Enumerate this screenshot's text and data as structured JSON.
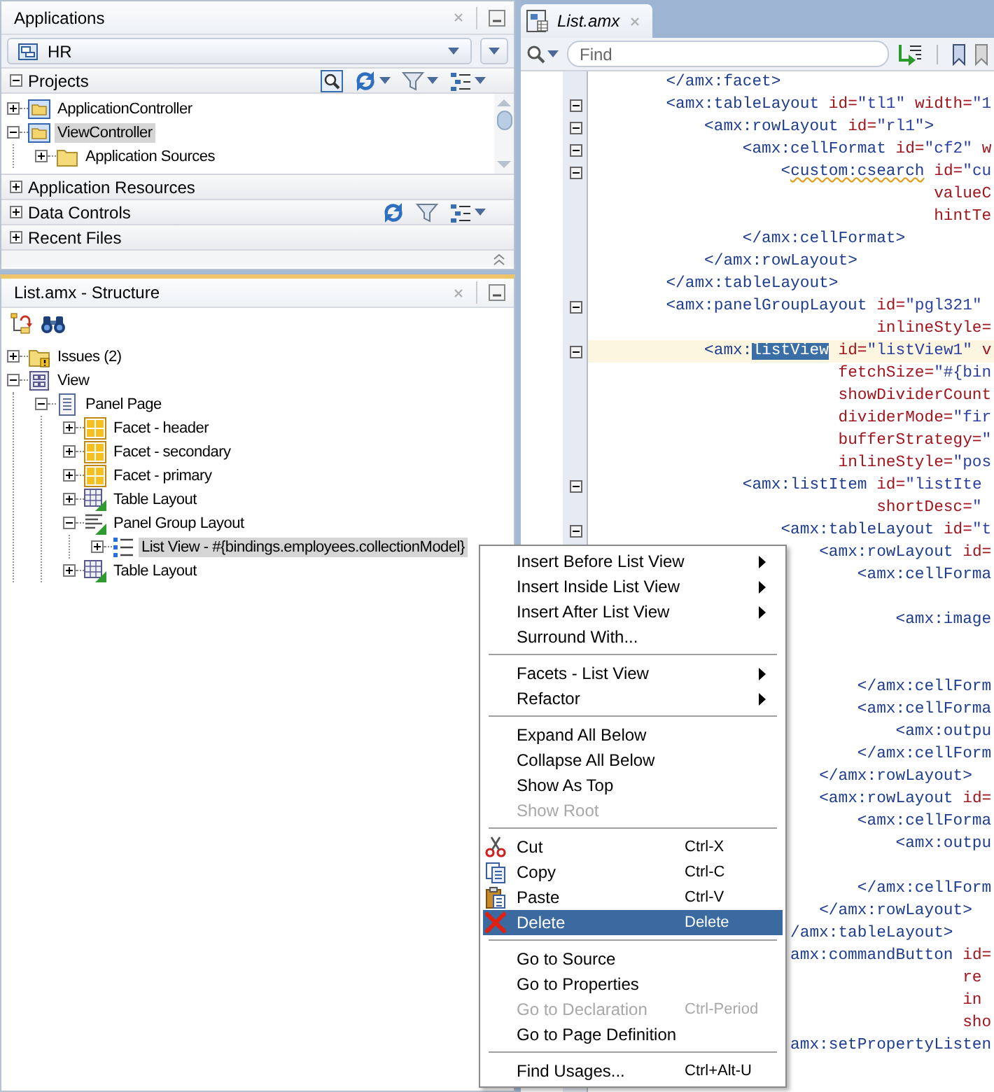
{
  "applications": {
    "title": "Applications",
    "application": "HR",
    "sections": [
      {
        "title": "Projects",
        "expanded": true,
        "tree": [
          {
            "label": "ApplicationController",
            "kind": "project",
            "expanded": false,
            "selected": false
          },
          {
            "label": "ViewController",
            "kind": "project",
            "expanded": true,
            "selected": true,
            "children": [
              {
                "label": "Application Sources",
                "kind": "folder",
                "expanded": false,
                "selected": false
              }
            ]
          }
        ]
      },
      {
        "title": "Application Resources",
        "expanded": false
      },
      {
        "title": "Data Controls",
        "expanded": false
      },
      {
        "title": "Recent Files",
        "expanded": false
      }
    ]
  },
  "structure": {
    "title": "List.amx - Structure",
    "tree": [
      {
        "label": "Issues (2)",
        "kind": "issues",
        "expanded": false,
        "selected": false
      },
      {
        "label": "View",
        "kind": "view",
        "expanded": true,
        "selected": false,
        "children": [
          {
            "label": "Panel Page",
            "kind": "page",
            "expanded": true,
            "selected": false,
            "children": [
              {
                "label": "Facet - header",
                "kind": "facet",
                "expanded": false,
                "selected": false
              },
              {
                "label": "Facet - secondary",
                "kind": "facet",
                "expanded": false,
                "selected": false
              },
              {
                "label": "Facet - primary",
                "kind": "facet",
                "expanded": false,
                "selected": false
              },
              {
                "label": "Table Layout",
                "kind": "table",
                "expanded": false,
                "selected": false
              },
              {
                "label": "Panel Group Layout",
                "kind": "panel_group",
                "expanded": true,
                "selected": false,
                "children": [
                  {
                    "label": "List View - #{bindings.employees.collectionModel}",
                    "kind": "list_view",
                    "expanded": false,
                    "selected": true
                  }
                ]
              },
              {
                "label": "Table Layout",
                "kind": "table",
                "expanded": false,
                "selected": false
              }
            ]
          }
        ]
      }
    ]
  },
  "editor": {
    "tabs": [
      {
        "label": "List.amx",
        "selected": true
      }
    ],
    "search": {
      "placeholder": "Find"
    },
    "lines": [
      {
        "kind": "code",
        "text": "        </amx:facet>",
        "fold": false,
        "current": false
      },
      {
        "kind": "code",
        "text": "        <amx:tableLayout id=\"tl1\" width=\"1",
        "fold": true,
        "current": false
      },
      {
        "kind": "code",
        "text": "            <amx:rowLayout id=\"rl1\">",
        "fold": true,
        "current": false
      },
      {
        "kind": "code",
        "text": "                <amx:cellFormat id=\"cf2\" w",
        "fold": true,
        "current": false
      },
      {
        "kind": "code",
        "segments": [
          {
            "text": "                    <",
            "kind": "plain"
          },
          {
            "text": "custom:csearch",
            "kind": "warning"
          },
          {
            "text": " id=\"cu",
            "kind": "plain"
          }
        ],
        "fold": true,
        "current": false
      },
      {
        "kind": "code",
        "text": "                                    valueC",
        "fold": false,
        "current": false
      },
      {
        "kind": "code",
        "text": "                                    hintTe",
        "fold": false,
        "current": false
      },
      {
        "kind": "code",
        "text": "                </amx:cellFormat>",
        "fold": false,
        "current": false
      },
      {
        "kind": "code",
        "text": "            </amx:rowLayout>",
        "fold": false,
        "current": false
      },
      {
        "kind": "code",
        "text": "        </amx:tableLayout>",
        "fold": false,
        "current": false
      },
      {
        "kind": "code",
        "text": "        <amx:panelGroupLayout id=\"pgl321\"",
        "fold": true,
        "current": false
      },
      {
        "kind": "code",
        "text": "                              inlineStyle=",
        "fold": false,
        "current": false
      },
      {
        "kind": "code",
        "segments": [
          {
            "text": "            <amx:",
            "kind": "plain"
          },
          {
            "text": "listView",
            "kind": "selected"
          },
          {
            "text": " id=\"listView1\" v",
            "kind": "plain"
          }
        ],
        "fold": true,
        "current": true
      },
      {
        "kind": "code",
        "text": "                          fetchSize=\"#{bin",
        "fold": false,
        "current": false
      },
      {
        "kind": "code",
        "text": "                          showDividerCount",
        "fold": false,
        "current": false
      },
      {
        "kind": "code",
        "text": "                          dividerMode=\"fir",
        "fold": false,
        "current": false
      },
      {
        "kind": "code",
        "text": "                          bufferStrategy=\"",
        "fold": false,
        "current": false
      },
      {
        "kind": "code",
        "text": "                          inlineStyle=\"pos",
        "fold": false,
        "current": false
      },
      {
        "kind": "code",
        "text": "                <amx:listItem id=\"listIte",
        "fold": true,
        "current": false
      },
      {
        "kind": "code",
        "text": "                              shortDesc=\"",
        "fold": false,
        "current": false
      },
      {
        "kind": "code",
        "text": "                    <amx:tableLayout id=\"t",
        "fold": true,
        "current": false
      },
      {
        "kind": "code",
        "text": "                        <amx:rowLayout id=",
        "fold": false,
        "current": false
      },
      {
        "kind": "code",
        "text": "                            <amx:cellForma",
        "fold": false,
        "current": false
      },
      {
        "kind": "blank",
        "fold": false,
        "current": false
      },
      {
        "kind": "code",
        "text": "                                <amx:image",
        "fold": false,
        "current": false
      },
      {
        "kind": "blank",
        "fold": false,
        "current": false
      },
      {
        "kind": "blank",
        "fold": false,
        "current": false
      },
      {
        "kind": "code",
        "text": "                            </amx:cellForm",
        "fold": false,
        "current": false
      },
      {
        "kind": "code",
        "text": "                            <amx:cellForma",
        "fold": false,
        "current": false
      },
      {
        "kind": "code",
        "text": "                                <amx:outpu",
        "fold": false,
        "current": false
      },
      {
        "kind": "code",
        "text": "                            </amx:cellForm",
        "fold": false,
        "current": false
      },
      {
        "kind": "code",
        "text": "                        </amx:rowLayout>",
        "fold": false,
        "current": false
      },
      {
        "kind": "code",
        "text": "                        <amx:rowLayout id=",
        "fold": false,
        "current": false
      },
      {
        "kind": "code",
        "text": "                            <amx:cellForma",
        "fold": false,
        "current": false
      },
      {
        "kind": "code",
        "text": "                                <amx:outpu",
        "fold": false,
        "current": false
      },
      {
        "kind": "blank",
        "fold": false,
        "current": false
      },
      {
        "kind": "code",
        "text": "                            </amx:cellForm",
        "fold": false,
        "current": false
      },
      {
        "kind": "code",
        "text": "                        </amx:rowLayout>",
        "fold": false,
        "current": false
      },
      {
        "kind": "code",
        "text": "                     /amx:tableLayout>",
        "fold": false,
        "current": false
      },
      {
        "kind": "code",
        "text": "                     amx:commandButton id=",
        "fold": false,
        "current": false
      },
      {
        "kind": "code",
        "text": "                                       re",
        "fold": false,
        "current": false
      },
      {
        "kind": "code",
        "text": "                                       in",
        "fold": false,
        "current": false
      },
      {
        "kind": "code",
        "text": "                                       sho",
        "fold": false,
        "current": false
      },
      {
        "kind": "code",
        "text": "                     amx:setPropertyListen",
        "fold": false,
        "current": false
      }
    ]
  },
  "context_menu": {
    "items": [
      {
        "kind": "item",
        "label": "Insert Before List View",
        "submenu": true,
        "disabled": false,
        "selected": false
      },
      {
        "kind": "item",
        "label": "Insert Inside List View",
        "submenu": true,
        "disabled": false,
        "selected": false
      },
      {
        "kind": "item",
        "label": "Insert After List View",
        "submenu": true,
        "disabled": false,
        "selected": false
      },
      {
        "kind": "item",
        "label": "Surround With...",
        "submenu": false,
        "disabled": false,
        "selected": false
      },
      {
        "kind": "separator"
      },
      {
        "kind": "item",
        "label": "Facets - List View",
        "submenu": true,
        "disabled": false,
        "selected": false
      },
      {
        "kind": "item",
        "label": "Refactor",
        "submenu": true,
        "disabled": false,
        "selected": false
      },
      {
        "kind": "separator"
      },
      {
        "kind": "item",
        "label": "Expand All Below",
        "submenu": false,
        "disabled": false,
        "selected": false
      },
      {
        "kind": "item",
        "label": "Collapse All Below",
        "submenu": false,
        "disabled": false,
        "selected": false
      },
      {
        "kind": "item",
        "label": "Show As Top",
        "submenu": false,
        "disabled": false,
        "selected": false
      },
      {
        "kind": "item",
        "label": "Show Root",
        "submenu": false,
        "disabled": true,
        "selected": false
      },
      {
        "kind": "separator"
      },
      {
        "kind": "icon_item",
        "label": "Cut",
        "shortcut": "Ctrl-X",
        "submenu": false,
        "disabled": false,
        "selected": false
      },
      {
        "kind": "icon_item",
        "label": "Copy",
        "shortcut": "Ctrl-C",
        "submenu": false,
        "disabled": false,
        "selected": false
      },
      {
        "kind": "icon_item",
        "label": "Paste",
        "shortcut": "Ctrl-V",
        "submenu": false,
        "disabled": false,
        "selected": false
      },
      {
        "kind": "icon_item",
        "label": "Delete",
        "shortcut": "Delete",
        "submenu": false,
        "disabled": false,
        "selected": true
      },
      {
        "kind": "separator"
      },
      {
        "kind": "item",
        "label": "Go to Source",
        "submenu": false,
        "disabled": false,
        "selected": false
      },
      {
        "kind": "item",
        "label": "Go to Properties",
        "submenu": false,
        "disabled": false,
        "selected": false
      },
      {
        "kind": "item",
        "label": "Go to Declaration",
        "shortcut": "Ctrl-Period",
        "submenu": false,
        "disabled": true,
        "selected": false
      },
      {
        "kind": "item",
        "label": "Go to Page Definition",
        "submenu": false,
        "disabled": false,
        "selected": false
      },
      {
        "kind": "separator"
      },
      {
        "kind": "item",
        "label": "Find Usages...",
        "shortcut": "Ctrl+Alt-U",
        "submenu": false,
        "disabled": false,
        "selected": false
      }
    ]
  }
}
